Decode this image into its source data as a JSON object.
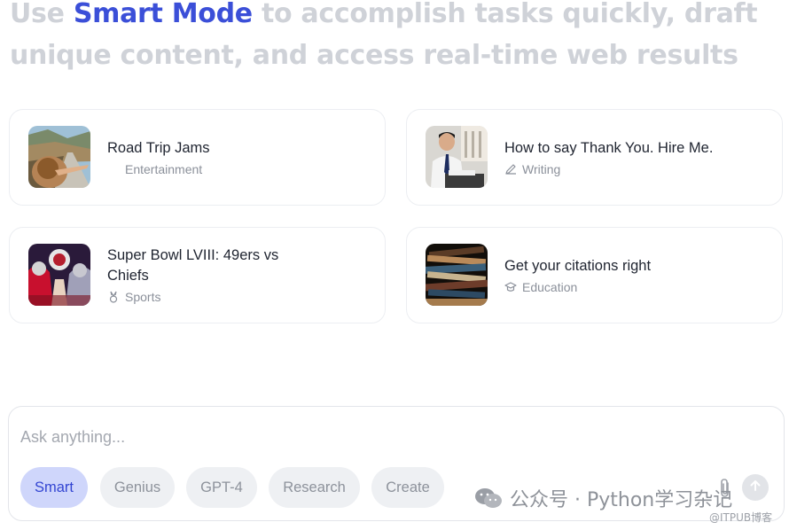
{
  "headline": {
    "prefix": "Use ",
    "highlight": "Smart Mode",
    "suffix": " to accomplish tasks quickly, draft unique content, and access real-time web results",
    "accent_color": "#3b4fd8",
    "muted_color": "#cfd2d8"
  },
  "cards": [
    {
      "title": "Road Trip Jams",
      "category": "Entertainment",
      "category_icon": "none",
      "thumb": "road-trip-photo"
    },
    {
      "title": "How to say Thank You. Hire Me.",
      "category": "Writing",
      "category_icon": "pencil-icon",
      "thumb": "office-man-photo"
    },
    {
      "title": "Super Bowl LVIII: 49ers vs Chiefs",
      "category": "Sports",
      "category_icon": "medal-icon",
      "thumb": "football-photo"
    },
    {
      "title": "Get your citations right",
      "category": "Education",
      "category_icon": "graduation-cap-icon",
      "thumb": "books-photo"
    }
  ],
  "composer": {
    "placeholder": "Ask anything...",
    "value": "",
    "modes": [
      "Smart",
      "Genius",
      "GPT-4",
      "Research",
      "Create"
    ],
    "selected_mode": "Smart",
    "attach_icon": "paperclip-icon",
    "send_icon": "arrow-up-icon"
  },
  "watermark": {
    "text": "公众号 · Python学习杂记",
    "source": "@ITPUB博客"
  }
}
